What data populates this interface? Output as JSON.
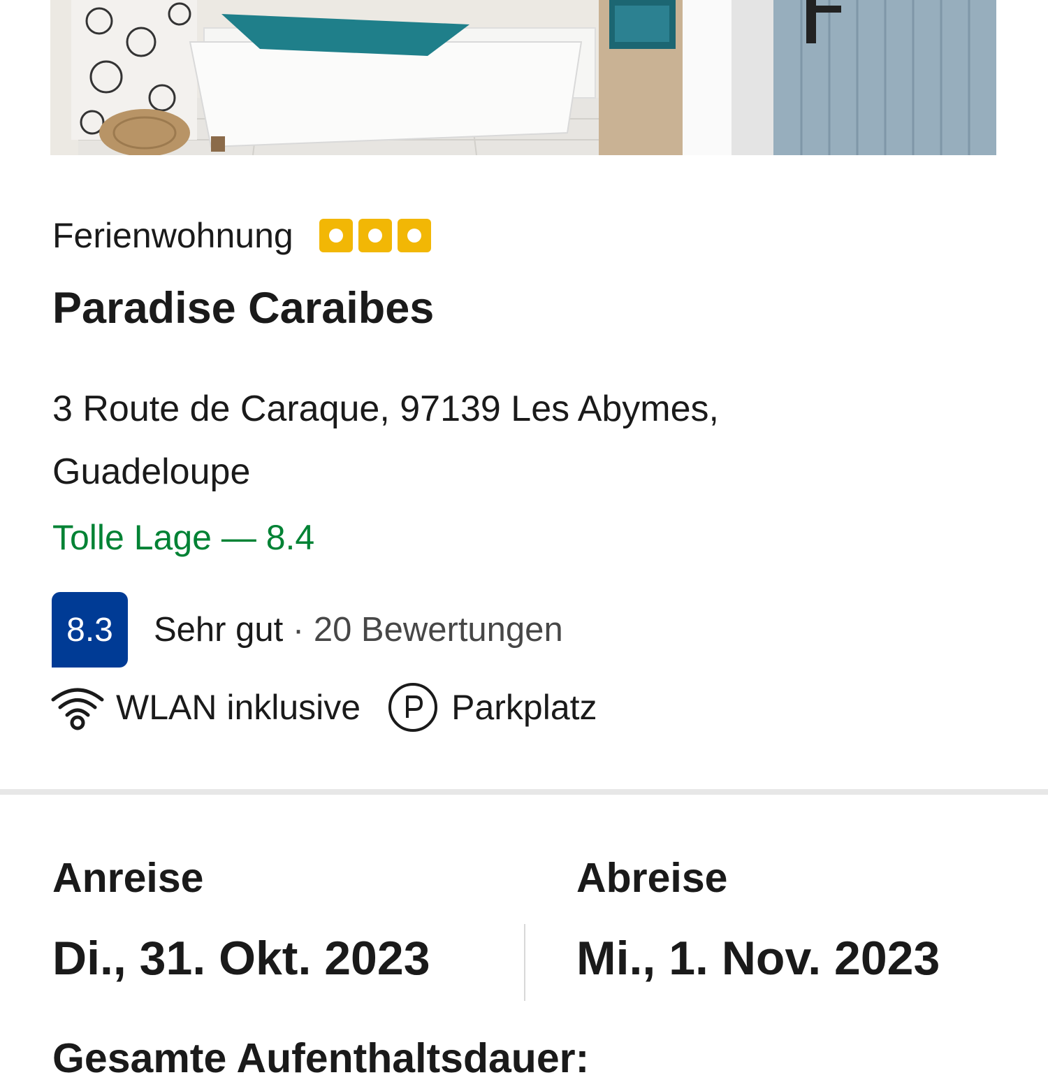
{
  "property": {
    "type": "Ferienwohnung",
    "star_count": 3,
    "star_color": "#f2b705",
    "name": "Paradise Caraibes",
    "address": "3 Route de Caraque, 97139 Les Abymes, Guadeloupe",
    "location": {
      "text": "Tolle Lage — 8.4",
      "color": "#008234"
    }
  },
  "review": {
    "score": "8.3",
    "rating_word": "Sehr gut",
    "separator": "·",
    "count_text": "20 Bewertungen",
    "badge_color": "#003b95"
  },
  "amenities": {
    "wifi": {
      "label": "WLAN inklusive",
      "icon": "wifi-icon"
    },
    "parking": {
      "label": "Parkplatz",
      "icon": "parking-icon"
    }
  },
  "dates": {
    "checkin_label": "Anreise",
    "checkin_value": "Di., 31. Okt. 2023",
    "checkout_label": "Abreise",
    "checkout_value": "Mi., 1. Nov. 2023"
  },
  "stay": {
    "label": "Gesamte Aufenthaltsdauer:"
  }
}
